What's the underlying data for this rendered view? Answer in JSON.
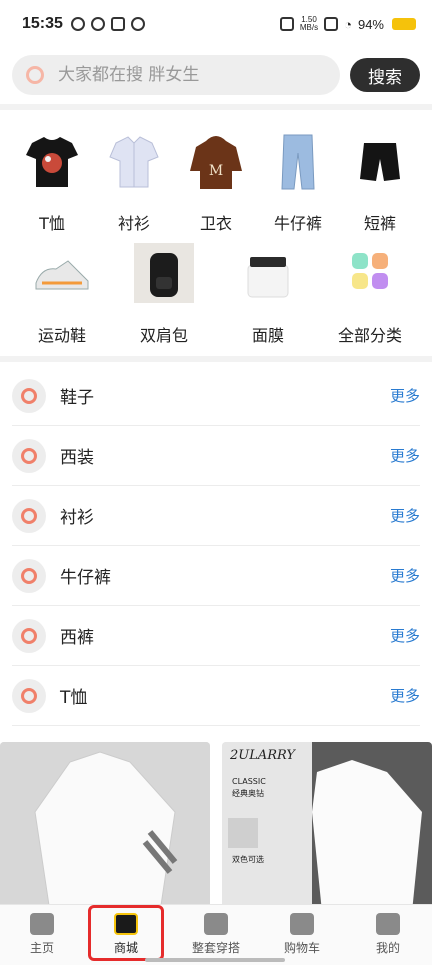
{
  "status": {
    "time": "15:35",
    "net_speed": "1.50\nMB/s",
    "battery": "94%"
  },
  "search": {
    "placeholder": "大家都在搜 胖女生",
    "button": "搜索"
  },
  "categories": [
    {
      "label": "T恤",
      "icon": "tshirt-icon"
    },
    {
      "label": "衬衫",
      "icon": "shirt-icon"
    },
    {
      "label": "卫衣",
      "icon": "hoodie-icon"
    },
    {
      "label": "牛仔裤",
      "icon": "jeans-icon"
    },
    {
      "label": "短裤",
      "icon": "shorts-icon"
    },
    {
      "label": "运动鞋",
      "icon": "sneaker-icon"
    },
    {
      "label": "双肩包",
      "icon": "backpack-icon"
    },
    {
      "label": "面膜",
      "icon": "mask-jar-icon"
    },
    {
      "label": "全部分类",
      "icon": "all-categories-icon"
    }
  ],
  "list": [
    {
      "label": "鞋子",
      "more": "更多"
    },
    {
      "label": "西装",
      "more": "更多"
    },
    {
      "label": "衬衫",
      "more": "更多"
    },
    {
      "label": "牛仔裤",
      "more": "更多"
    },
    {
      "label": "西裤",
      "more": "更多"
    },
    {
      "label": "T恤",
      "more": "更多"
    }
  ],
  "products": [
    {
      "image_text": ""
    },
    {
      "brand": "2ULARRY",
      "lines": [
        "CLASSIC",
        "经典奥钻",
        "双色可选"
      ]
    }
  ],
  "tabs": [
    {
      "label": "主页",
      "icon": "home-icon"
    },
    {
      "label": "商城",
      "icon": "shopping-bag-icon",
      "active": true
    },
    {
      "label": "整套穿搭",
      "icon": "outfit-icon"
    },
    {
      "label": "购物车",
      "icon": "cart-icon"
    },
    {
      "label": "我的",
      "icon": "profile-icon"
    }
  ],
  "colors": {
    "accent": "#f6c40c",
    "highlight": "#e52b2b",
    "link": "#2a7bd0"
  }
}
